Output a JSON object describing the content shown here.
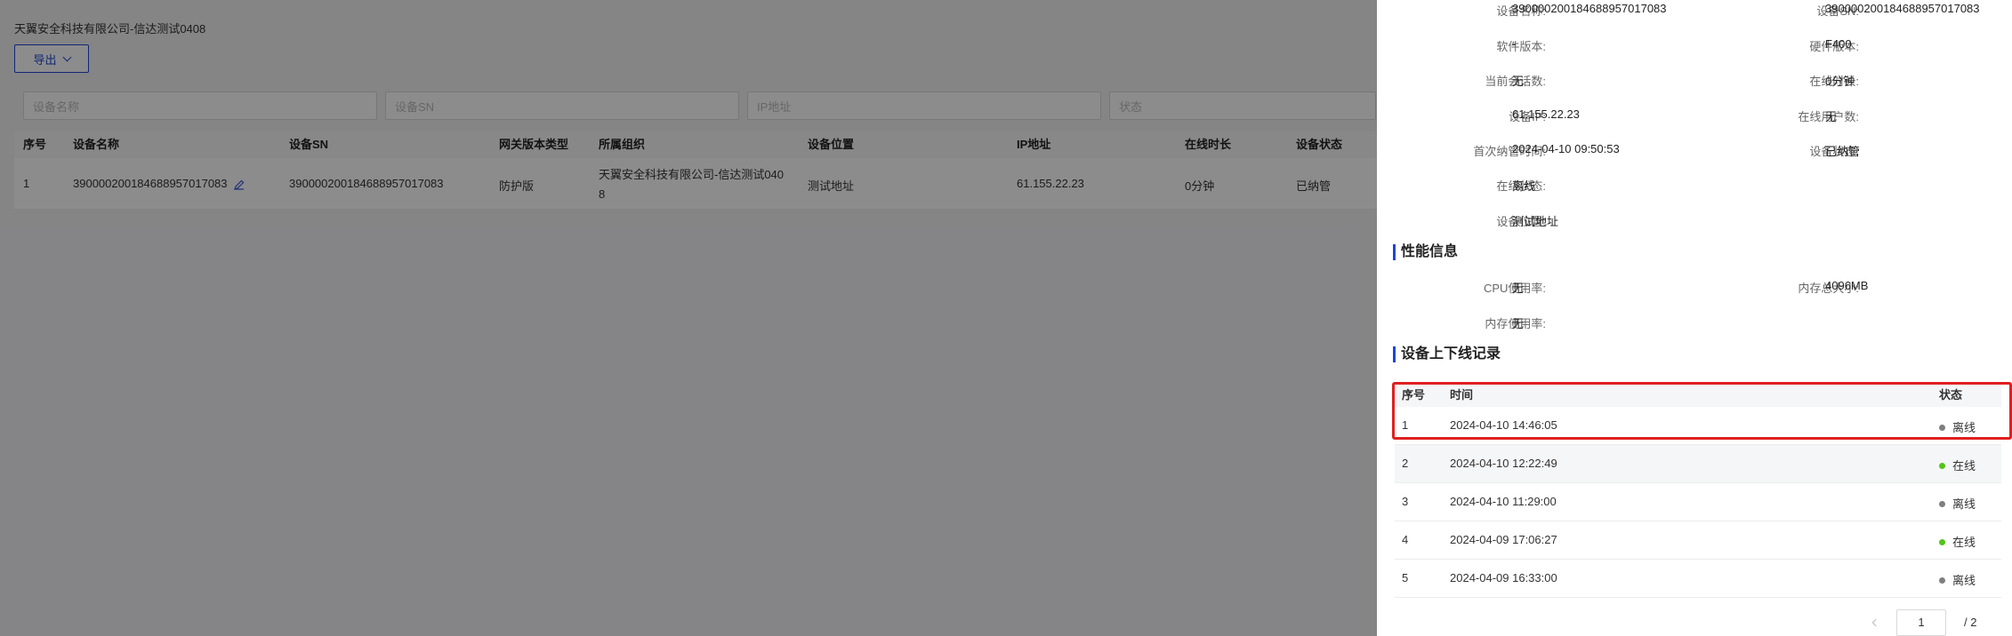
{
  "page": {
    "breadcrumb": "天翼安全科技有限公司-信达测试0408",
    "export_label": "导出",
    "filters": {
      "device_name": "设备名称",
      "device_sn": "设备SN",
      "ip": "IP地址",
      "status": "状态"
    },
    "table": {
      "headers": [
        "序号",
        "设备名称",
        "设备SN",
        "网关版本类型",
        "所属组织",
        "设备位置",
        "IP地址",
        "在线时长",
        "设备状态"
      ],
      "row": {
        "index": "1",
        "name": "390000200184688957017083",
        "sn": "390000200184688957017083",
        "version_type": "防护版",
        "org_line1": "天翼安全科技有限公司-信达测试040",
        "org_line2": "8",
        "location": "测试地址",
        "ip": "61.155.22.23",
        "online_duration": "0分钟",
        "status": "已纳管"
      }
    }
  },
  "drawer": {
    "basic_info": {
      "device_name_label": "设备名称:",
      "device_name_value": "390000200184688957017083",
      "device_sn_label": "设备SN:",
      "device_sn_value": "390000200184688957017083",
      "software_version_label": "软件版本:",
      "software_version_value": "-",
      "hardware_version_label": "硬件版本:",
      "hardware_version_value": "F400",
      "sessions_label": "当前会话数:",
      "sessions_value": "无",
      "online_duration_label": "在线时长:",
      "online_duration_value": "0分钟",
      "device_ip_label": "设备IP:",
      "device_ip_value": "61.155.22.23",
      "online_users_label": "在线用户数:",
      "online_users_value": "无",
      "first_managed_label": "首次纳管时间:",
      "first_managed_value": "2024-04-10 09:50:53",
      "device_status_label": "设备状态:",
      "device_status_value": "已纳管",
      "online_status_label": "在线状态:",
      "online_status_value": "离线",
      "location_label": "设备位置:",
      "location_value": "测试地址"
    },
    "performance": {
      "title": "性能信息",
      "cpu_label": "CPU使用率:",
      "cpu_value": "无",
      "mem_total_label": "内存总大小:",
      "mem_total_value": "4096MB",
      "mem_usage_label": "内存使用率:",
      "mem_usage_value": "无"
    },
    "records": {
      "title": "设备上下线记录",
      "headers": {
        "index": "序号",
        "time": "时间",
        "status": "状态"
      },
      "rows": [
        {
          "index": "1",
          "time": "2024-04-10 14:46:05",
          "status": "离线",
          "color": "#7f7f7f"
        },
        {
          "index": "2",
          "time": "2024-04-10 12:22:49",
          "status": "在线",
          "color": "#52c41a"
        },
        {
          "index": "3",
          "time": "2024-04-10 11:29:00",
          "status": "离线",
          "color": "#7f7f7f"
        },
        {
          "index": "4",
          "time": "2024-04-09 17:06:27",
          "status": "在线",
          "color": "#52c41a"
        },
        {
          "index": "5",
          "time": "2024-04-09 16:33:00",
          "status": "离线",
          "color": "#7f7f7f"
        }
      ]
    },
    "pagination": {
      "current": "1",
      "total": "/ 2"
    }
  }
}
